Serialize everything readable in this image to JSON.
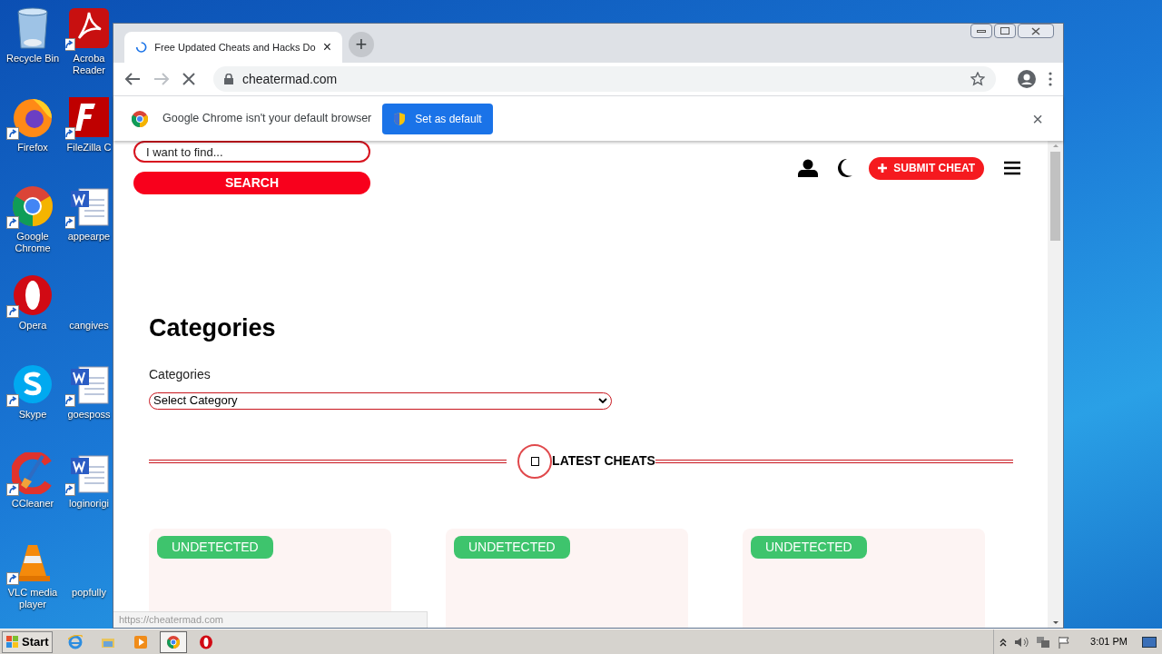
{
  "desktop": {
    "icons_column_1": [
      {
        "label": "Recycle Bin",
        "kind": "recycle"
      },
      {
        "label": "Firefox",
        "kind": "firefox"
      },
      {
        "label": "Google Chrome",
        "kind": "chrome"
      },
      {
        "label": "Opera",
        "kind": "opera"
      },
      {
        "label": "Skype",
        "kind": "skype"
      },
      {
        "label": "CCleaner",
        "kind": "ccleaner"
      },
      {
        "label": "VLC media player",
        "kind": "vlc"
      }
    ],
    "icons_column_2": [
      {
        "label": "Acroba Reader",
        "kind": "pdf"
      },
      {
        "label": "FileZilla C",
        "kind": "filezilla"
      },
      {
        "label": "appearpe",
        "kind": "word"
      },
      {
        "label": "cangives",
        "kind": "blank"
      },
      {
        "label": "goesposs",
        "kind": "word"
      },
      {
        "label": "loginorigi",
        "kind": "word"
      },
      {
        "label": "popfully",
        "kind": "blank"
      }
    ]
  },
  "browser": {
    "tab": {
      "title": "Free Updated Cheats and Hacks Do",
      "close": "×",
      "loading": true
    },
    "new_tab": "+",
    "address": "cheatermad.com",
    "infobar": {
      "message": "Google Chrome isn't your default browser",
      "button": "Set as default",
      "close": "×"
    },
    "status_url": "https://cheatermad.com"
  },
  "page": {
    "search": {
      "placeholder": "I want to find...",
      "button": "SEARCH"
    },
    "submit_button": "SUBMIT CHEAT",
    "heading": "Categories",
    "category_label": "Categories",
    "category_select": "Select Category",
    "section_title": "LATEST CHEATS",
    "cards": [
      {
        "badge": "UNDETECTED"
      },
      {
        "badge": "UNDETECTED"
      },
      {
        "badge": "UNDETECTED"
      }
    ]
  },
  "taskbar": {
    "start": "Start",
    "apps": [
      {
        "kind": "ie",
        "selected": false
      },
      {
        "kind": "explorer",
        "selected": false
      },
      {
        "kind": "media",
        "selected": false
      },
      {
        "kind": "chrome",
        "selected": true
      },
      {
        "kind": "opera",
        "selected": false
      }
    ],
    "clock": "3:01 PM"
  }
}
